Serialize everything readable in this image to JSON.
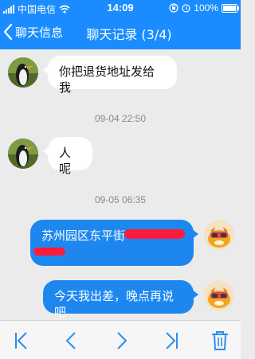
{
  "status_bar": {
    "carrier": "中国电信",
    "time": "14:09",
    "battery": "100%",
    "battery_level": 1.0,
    "icons": [
      "signal-icon",
      "wifi-icon",
      "orientation-lock-icon",
      "alarm-icon",
      "battery-icon"
    ]
  },
  "nav": {
    "back_label": "聊天信息",
    "title": "聊天记录 (3/4)"
  },
  "messages": [
    {
      "direction": "incoming",
      "text": "你把退货地址发给我"
    },
    {
      "timestamp": "09-04 22:50"
    },
    {
      "direction": "incoming",
      "text": "人呢"
    },
    {
      "timestamp": "09-05 06:35"
    },
    {
      "direction": "outgoing",
      "text": "苏州园区东平街",
      "redacted": true
    },
    {
      "direction": "outgoing",
      "text": "今天我出差，晚点再说吧"
    }
  ],
  "toolbar": {
    "buttons": [
      "first-page-icon",
      "previous-page-icon",
      "next-page-icon",
      "last-page-icon",
      "delete-icon"
    ]
  },
  "colors": {
    "accent": "#1a8cff",
    "outgoing_bubble": "#1d87ef",
    "incoming_bubble": "#ffffff",
    "background": "#ebebeb",
    "redaction": "#ff1a3c"
  }
}
